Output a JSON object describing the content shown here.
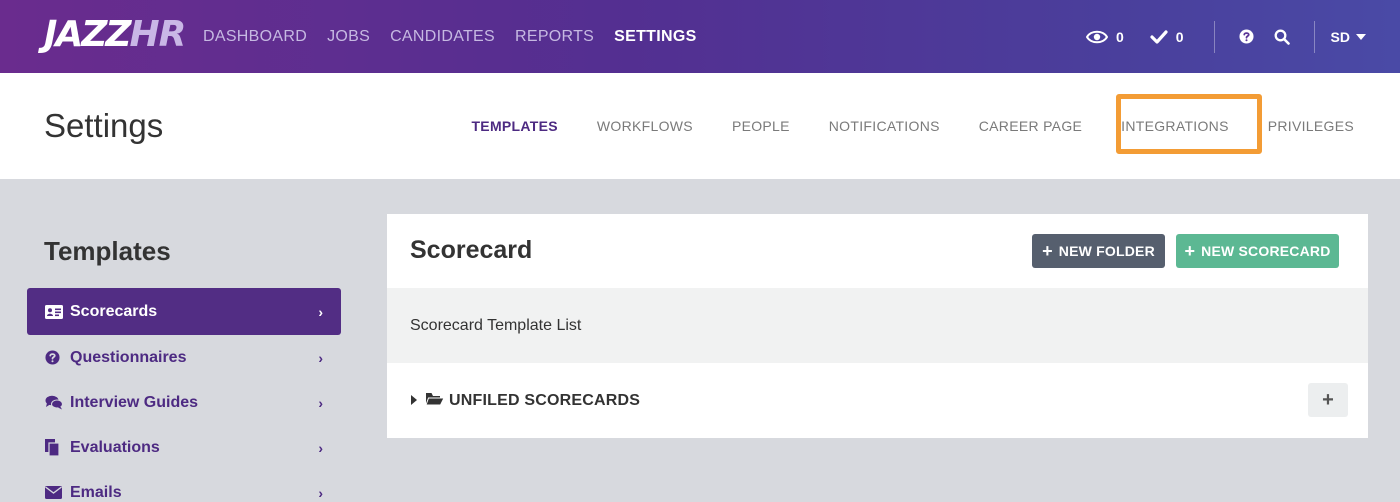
{
  "brand": {
    "logo_main": "JAZZ",
    "logo_sub": "HR"
  },
  "nav": {
    "items": [
      {
        "label": "DASHBOARD",
        "active": false
      },
      {
        "label": "JOBS",
        "active": false
      },
      {
        "label": "CANDIDATES",
        "active": false
      },
      {
        "label": "REPORTS",
        "active": false
      },
      {
        "label": "SETTINGS",
        "active": true
      }
    ],
    "views_count": "0",
    "tasks_count": "0",
    "user_initials": "SD"
  },
  "settings": {
    "title": "Settings",
    "tabs": [
      {
        "label": "TEMPLATES",
        "active": true
      },
      {
        "label": "WORKFLOWS",
        "active": false
      },
      {
        "label": "PEOPLE",
        "active": false
      },
      {
        "label": "NOTIFICATIONS",
        "active": false
      },
      {
        "label": "CAREER PAGE",
        "active": false
      },
      {
        "label": "INTEGRATIONS",
        "active": false,
        "highlighted": true
      },
      {
        "label": "PRIVILEGES",
        "active": false
      }
    ]
  },
  "sidebar": {
    "title": "Templates",
    "items": [
      {
        "label": "Scorecards",
        "icon": "id-card-icon",
        "active": true
      },
      {
        "label": "Questionnaires",
        "icon": "question-circle-icon",
        "active": false
      },
      {
        "label": "Interview Guides",
        "icon": "chat-bubbles-icon",
        "active": false
      },
      {
        "label": "Evaluations",
        "icon": "documents-icon",
        "active": false
      },
      {
        "label": "Emails",
        "icon": "envelope-icon",
        "active": false
      }
    ]
  },
  "panel": {
    "title": "Scorecard",
    "new_folder_label": "NEW FOLDER",
    "new_scorecard_label": "NEW SCORECARD",
    "list_header": "Scorecard Template List",
    "folder_label": "UNFILED SCORECARDS",
    "add_label": "+"
  },
  "colors": {
    "brand_purple": "#522d84",
    "highlight_orange": "#f39c35",
    "new_scorecard_green": "#5cb893",
    "new_folder_gray": "#565f6e"
  }
}
